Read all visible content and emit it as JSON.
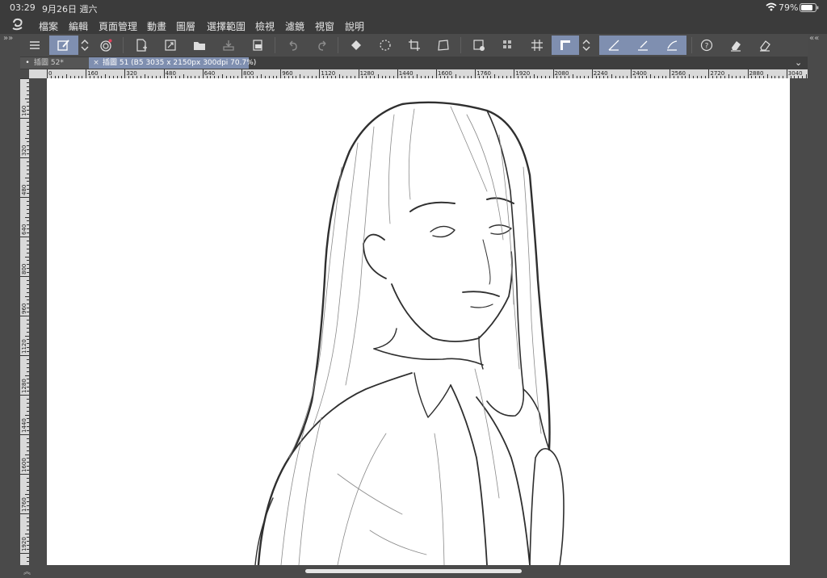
{
  "status": {
    "time": "03:29",
    "date": "9月26日 週六",
    "battery": "79%"
  },
  "menu": {
    "items": [
      "檔案",
      "編輯",
      "頁面管理",
      "動畫",
      "圖層",
      "選擇範圍",
      "檢視",
      "濾鏡",
      "視窗",
      "說明"
    ]
  },
  "toolbar": {
    "icons": [
      "menu-icon",
      "layer-brush-icon",
      "up-down-arrows-icon",
      "camera-record-icon",
      "new-file-icon",
      "resize-icon",
      "open-folder-icon",
      "save-icon",
      "export-icon",
      "undo-icon",
      "redo-icon",
      "fill-icon",
      "selection-icon",
      "crop-icon",
      "transform-icon",
      "new-layer-icon",
      "color-pick-icon",
      "grid-icon",
      "ruler-icon",
      "snap-arrows-icon",
      "snap-ruler-icon",
      "snap-line-icon",
      "snap-curve-icon",
      "help-icon",
      "eraser-icon",
      "eraser-alt-icon"
    ]
  },
  "tabs": [
    {
      "label": "插圖 52*",
      "active": false
    },
    {
      "label": "插圖 51 (B5 3035 x 2150px 300dpi 70.7%)",
      "active": true
    }
  ],
  "ruler": {
    "h_labels": [
      "0",
      "160",
      "320",
      "480",
      "640",
      "800",
      "960",
      "1120",
      "1280",
      "1440",
      "1600",
      "1760",
      "1920",
      "2080",
      "2240",
      "2400",
      "2560",
      "2720",
      "2880",
      "3040"
    ],
    "v_labels": [
      "160",
      "320",
      "480",
      "640",
      "800",
      "960",
      "1120",
      "1280",
      "1440",
      "1600",
      "1760",
      "1920",
      "80"
    ]
  },
  "colors": {
    "accent": "#7f8fb0",
    "chrome_dark": "#3b3b3b",
    "chrome": "#4a4a4a",
    "paper": "#ffffff",
    "ink": "#2f2f2f"
  }
}
